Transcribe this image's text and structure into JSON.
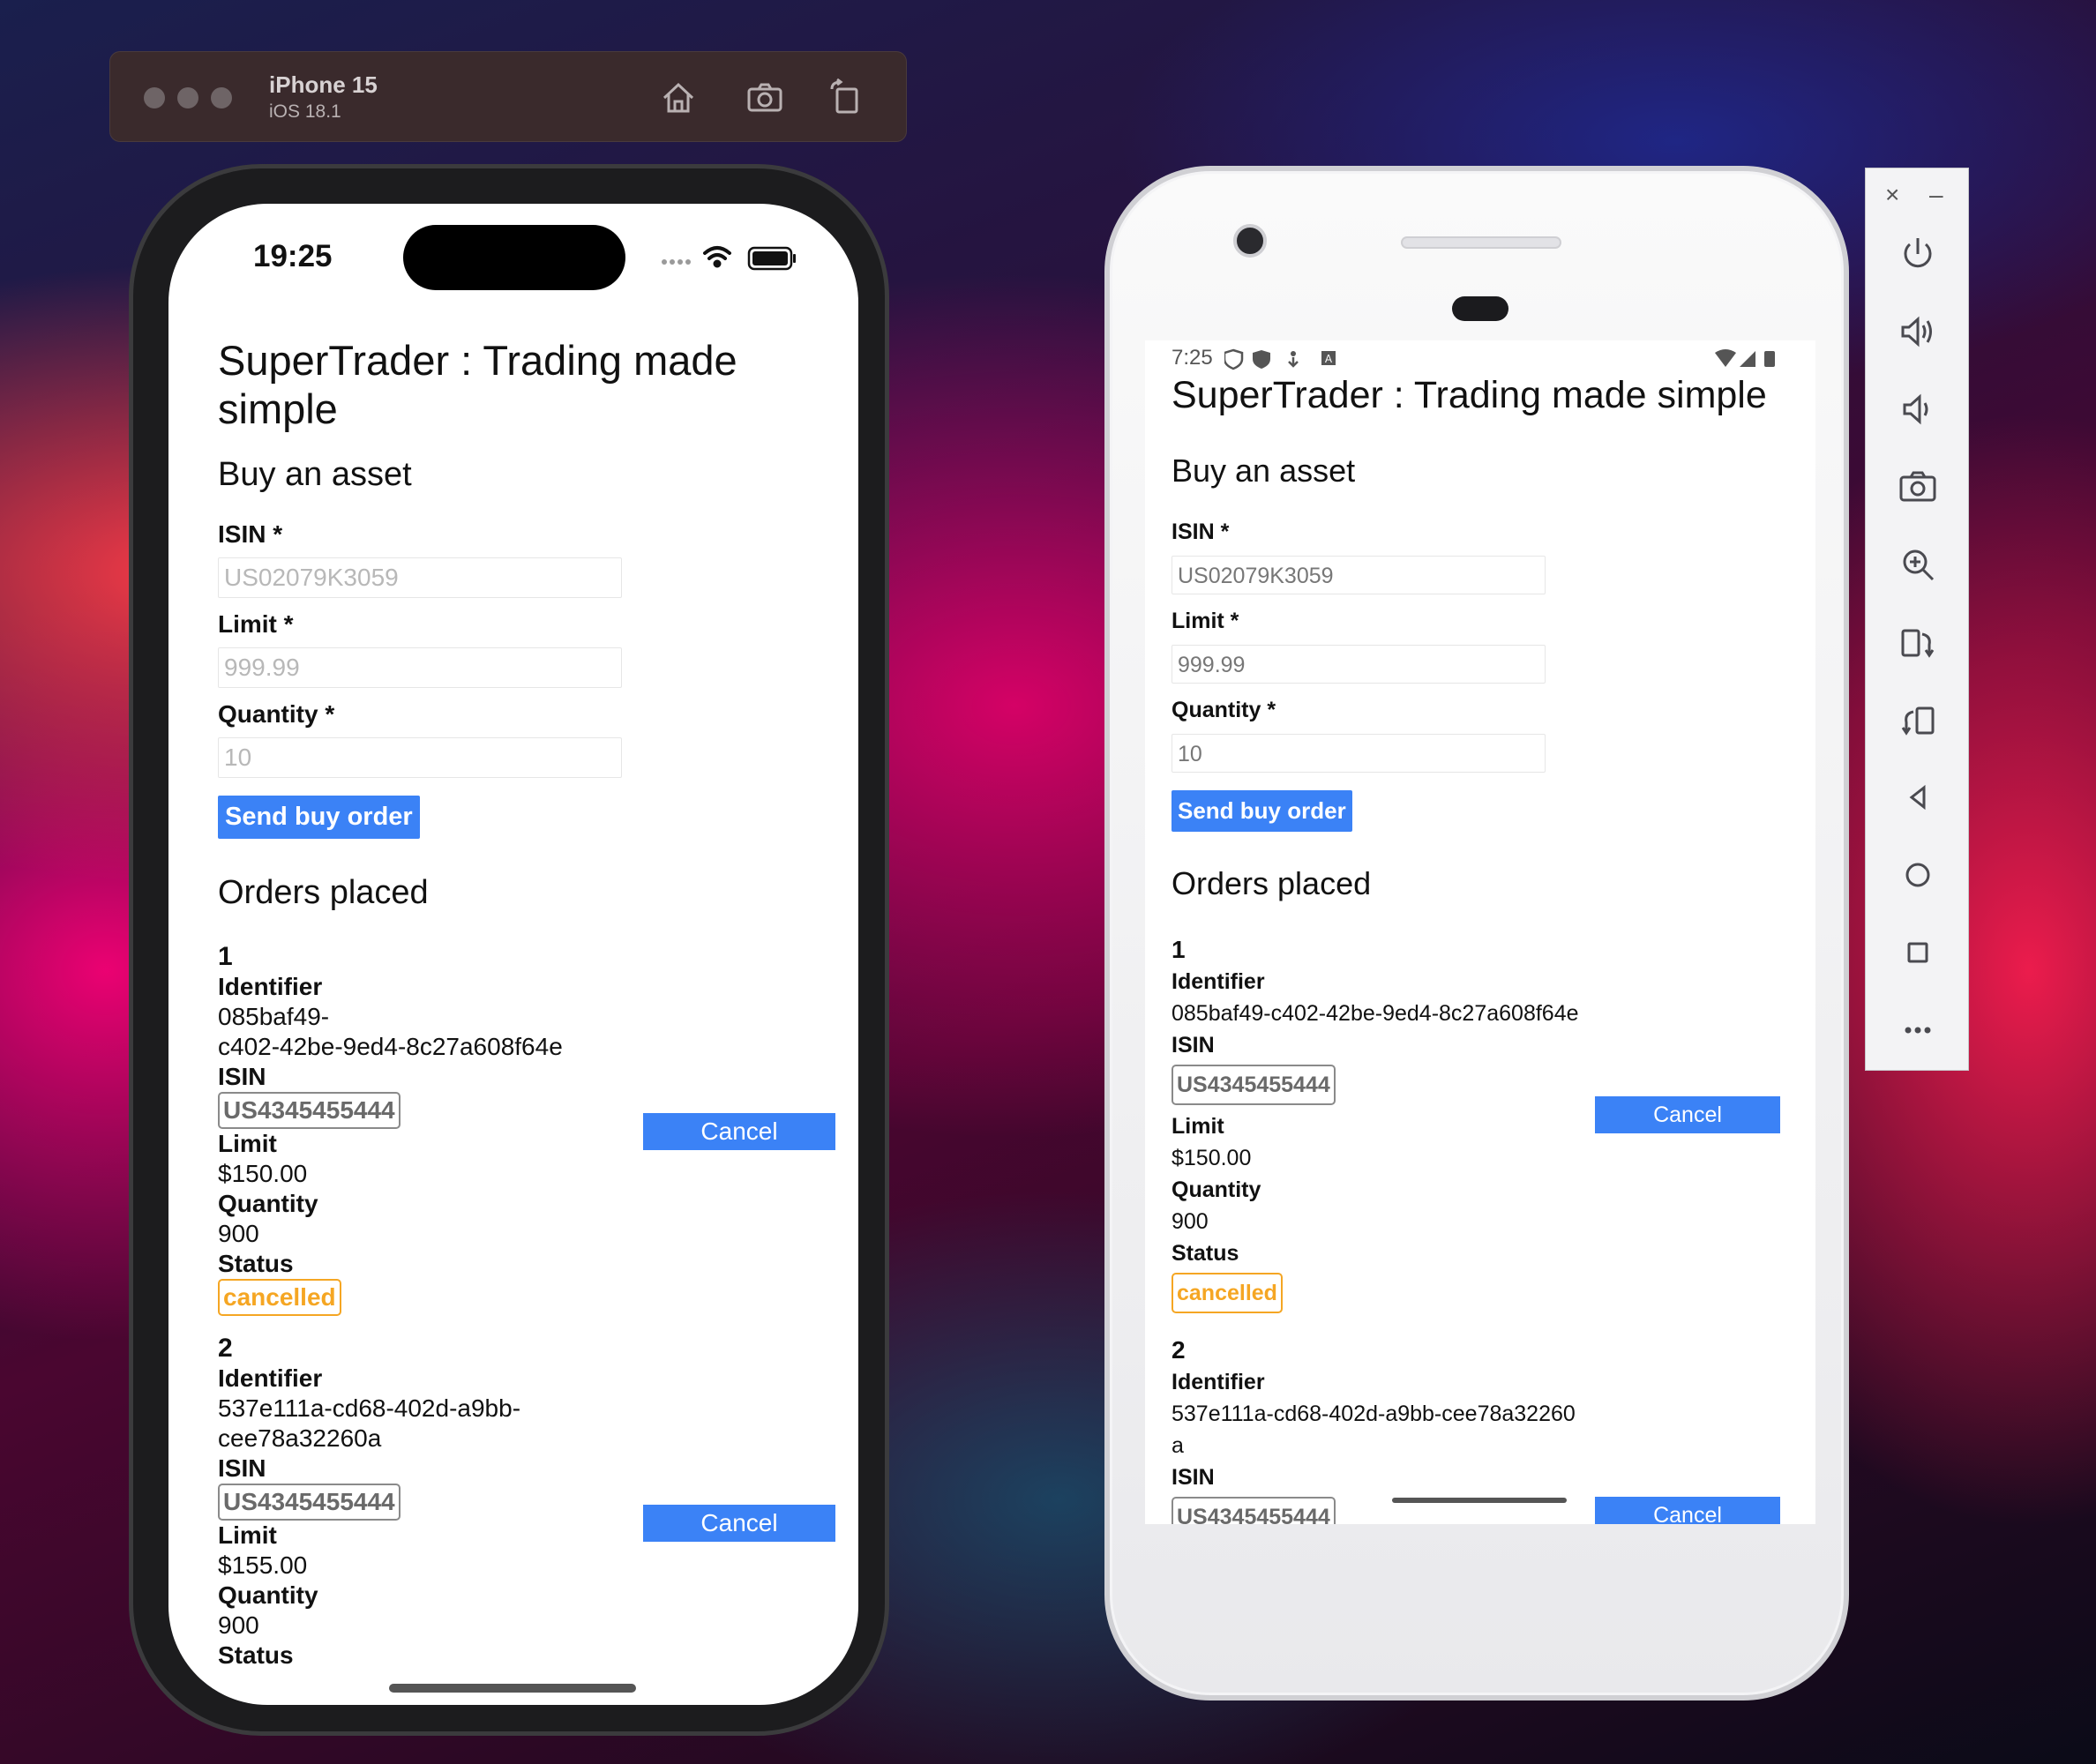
{
  "simulator": {
    "device": "iPhone 15",
    "os": "iOS 18.1",
    "buttons": [
      "home-icon",
      "screenshot-icon",
      "rotate-icon"
    ]
  },
  "ios": {
    "time": "19:25",
    "app": {
      "title": "SuperTrader : Trading made simple",
      "buy_heading": "Buy an asset",
      "isin_label": "ISIN *",
      "isin_placeholder": "US02079K3059",
      "limit_label": "Limit *",
      "limit_placeholder": "999.99",
      "quantity_label": "Quantity *",
      "quantity_placeholder": "10",
      "send_button": "Send buy order",
      "orders_heading": "Orders placed",
      "orders": [
        {
          "number": "1",
          "identifier_label": "Identifier",
          "identifier": "085baf49-c402-42be-9ed4-8c27a608f64e",
          "isin_label": "ISIN",
          "isin": "US4345455444",
          "limit_label": "Limit",
          "limit": "$150.00",
          "quantity_label": "Quantity",
          "quantity": "900",
          "status_label": "Status",
          "status": "cancelled",
          "cancel": "Cancel"
        },
        {
          "number": "2",
          "identifier_label": "Identifier",
          "identifier": "537e111a-cd68-402d-a9bb-cee78a32260a",
          "isin_label": "ISIN",
          "isin": "US4345455444",
          "limit_label": "Limit",
          "limit": "$155.00",
          "quantity_label": "Quantity",
          "quantity": "900",
          "status_label": "Status",
          "cancel": "Cancel"
        }
      ]
    }
  },
  "android": {
    "time": "7:25",
    "app": {
      "title": "SuperTrader : Trading made simple",
      "buy_heading": "Buy an asset",
      "isin_label": "ISIN *",
      "isin_value": "US02079K3059",
      "limit_label": "Limit *",
      "limit_value": "999.99",
      "quantity_label": "Quantity *",
      "quantity_value": "10",
      "send_button": "Send buy order",
      "orders_heading": "Orders placed",
      "orders": [
        {
          "number": "1",
          "identifier_label": "Identifier",
          "identifier": "085baf49-c402-42be-9ed4-8c27a608f64e",
          "isin_label": "ISIN",
          "isin": "US4345455444",
          "limit_label": "Limit",
          "limit": "$150.00",
          "quantity_label": "Quantity",
          "quantity": "900",
          "status_label": "Status",
          "status": "cancelled",
          "cancel": "Cancel"
        },
        {
          "number": "2",
          "identifier_label": "Identifier",
          "identifier": "537e111a-cd68-402d-a9bb-cee78a32260a",
          "isin_label": "ISIN",
          "isin": "US4345455444",
          "cancel": "Cancel"
        }
      ]
    }
  },
  "emulator_toolbar": {
    "close": "×",
    "minimize": "–",
    "items": [
      "power-icon",
      "volume-up-icon",
      "volume-down-icon",
      "camera-icon",
      "zoom-icon",
      "rotate-left-icon",
      "rotate-right-icon",
      "back-icon",
      "home-icon",
      "overview-icon",
      "more-icon"
    ]
  },
  "colors": {
    "accent_blue": "#3b82f6",
    "status_cancelled": "#f5a623"
  }
}
